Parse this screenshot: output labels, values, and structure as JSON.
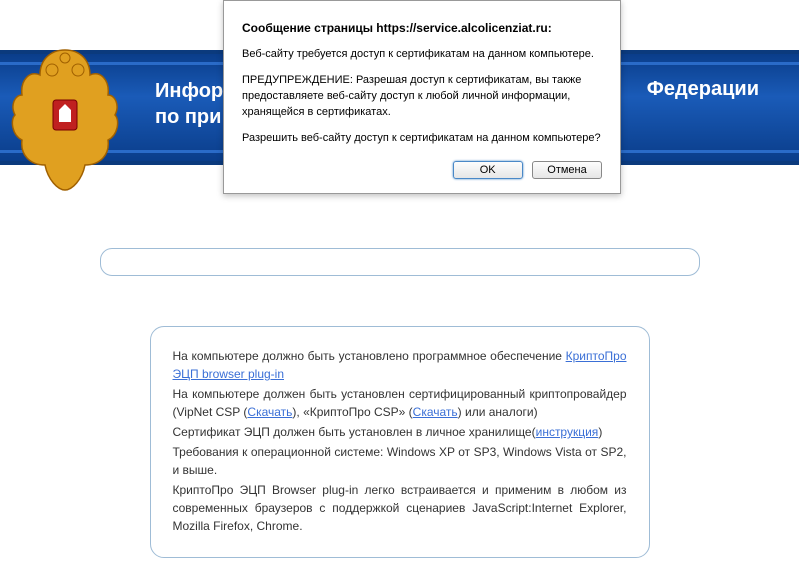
{
  "header": {
    "title_left_l1": "Информ",
    "title_left_l2": "по при",
    "title_right": "Федерации"
  },
  "dialog": {
    "title": "Сообщение страницы https://service.alcolicenziat.ru:",
    "line1": "Веб-сайту требуется доступ к сертификатам на данном компьютере.",
    "line2": "ПРЕДУПРЕЖДЕНИЕ: Разрешая доступ к сертификатам, вы также предоставляете веб-сайту доступ к любой личной информации, хранящейся в сертификатах.",
    "line3": "Разрешить веб-сайту доступ к сертификатам на данном компьютере?",
    "ok": "OK",
    "cancel": "Отмена"
  },
  "info": {
    "p1a": "На компьютере должно быть установлено программное обеспечение ",
    "p1link": "КриптоПро ЭЦП browser plug-in",
    "p2a": "На компьютере должен быть установлен сертифицированный криптопровайдер (VipNet CSP (",
    "p2link1": "Скачать",
    "p2b": "), «КриптоПро CSP» (",
    "p2link2": "Скачать",
    "p2c": ") или аналоги)",
    "p3a": "Сертификат ЭЦП должен быть установлен в личное хранилище(",
    "p3link": "инструкция",
    "p3b": ")",
    "p4": "Требования к операционной системе: Windows XP от SP3, Windows Vista от SP2, и выше.",
    "p5": "КриптоПро ЭЦП Browser plug-in легко встраивается и применим в любом из современных браузеров с поддержкой сценариев JavaScript:Internet Explorer, Mozilla Firefox, Chrome."
  }
}
